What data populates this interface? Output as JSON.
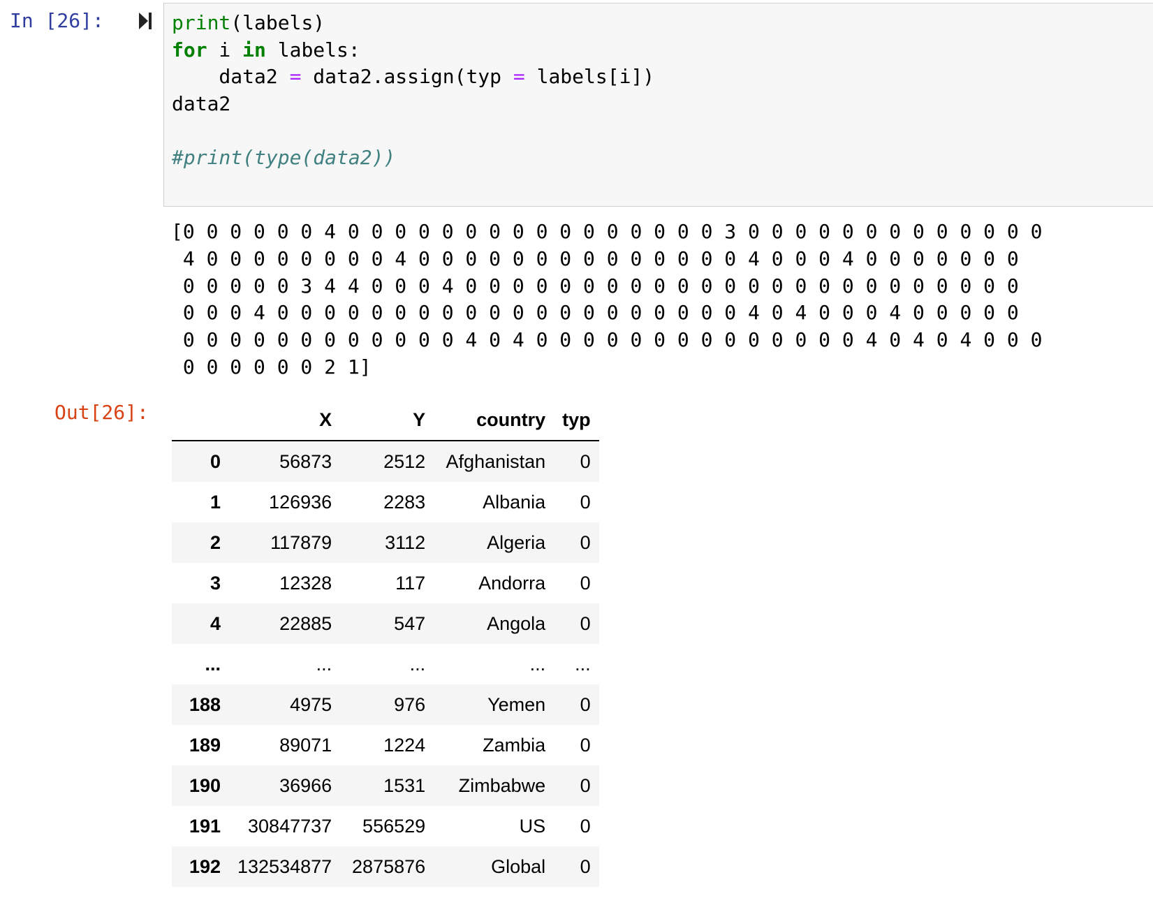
{
  "cell": {
    "in_prompt": "In [26]:",
    "out_prompt": "Out[26]:",
    "code": {
      "line1_fn": "print",
      "line1_rest": "(labels)",
      "line2_for": "for",
      "line2_var": " i ",
      "line2_in": "in",
      "line2_rest": " labels:",
      "line3_lhs": "    data2 ",
      "line3_eq": "=",
      "line3_mid": " data2.assign(typ ",
      "line3_eq2": "=",
      "line3_rest": " labels[i])",
      "line4": "data2",
      "line6_comment": "#print(type(data2))"
    },
    "run_icon": "run-cell-icon"
  },
  "stdout": {
    "lines": [
      "[0 0 0 0 0 0 4 0 0 0 0 0 0 0 0 0 0 0 0 0 0 0 0 3 0 0 0 0 0 0 0 0 0 0 0 0 0",
      " 4 0 0 0 0 0 0 0 0 4 0 0 0 0 0 0 0 0 0 0 0 0 0 0 4 0 0 0 4 0 0 0 0 0 0 0",
      " 0 0 0 0 0 3 4 4 0 0 0 4 0 0 0 0 0 0 0 0 0 0 0 0 0 0 0 0 0 0 0 0 0 0 0 0",
      " 0 0 0 4 0 0 0 0 0 0 0 0 0 0 0 0 0 0 0 0 0 0 0 0 4 0 4 0 0 0 4 0 0 0 0 0",
      " 0 0 0 0 0 0 0 0 0 0 0 0 4 0 4 0 0 0 0 0 0 0 0 0 0 0 0 0 0 4 0 4 0 4 0 0 0",
      " 0 0 0 0 0 0 2 1]"
    ]
  },
  "dataframe": {
    "columns": [
      "",
      "X",
      "Y",
      "country",
      "typ"
    ],
    "rows": [
      {
        "idx": "0",
        "X": "56873",
        "Y": "2512",
        "country": "Afghanistan",
        "typ": "0"
      },
      {
        "idx": "1",
        "X": "126936",
        "Y": "2283",
        "country": "Albania",
        "typ": "0"
      },
      {
        "idx": "2",
        "X": "117879",
        "Y": "3112",
        "country": "Algeria",
        "typ": "0"
      },
      {
        "idx": "3",
        "X": "12328",
        "Y": "117",
        "country": "Andorra",
        "typ": "0"
      },
      {
        "idx": "4",
        "X": "22885",
        "Y": "547",
        "country": "Angola",
        "typ": "0"
      },
      {
        "idx": "...",
        "X": "...",
        "Y": "...",
        "country": "...",
        "typ": "..."
      },
      {
        "idx": "188",
        "X": "4975",
        "Y": "976",
        "country": "Yemen",
        "typ": "0"
      },
      {
        "idx": "189",
        "X": "89071",
        "Y": "1224",
        "country": "Zambia",
        "typ": "0"
      },
      {
        "idx": "190",
        "X": "36966",
        "Y": "1531",
        "country": "Zimbabwe",
        "typ": "0"
      },
      {
        "idx": "191",
        "X": "30847737",
        "Y": "556529",
        "country": "US",
        "typ": "0"
      },
      {
        "idx": "192",
        "X": "132534877",
        "Y": "2875876",
        "country": "Global",
        "typ": "0"
      }
    ]
  }
}
